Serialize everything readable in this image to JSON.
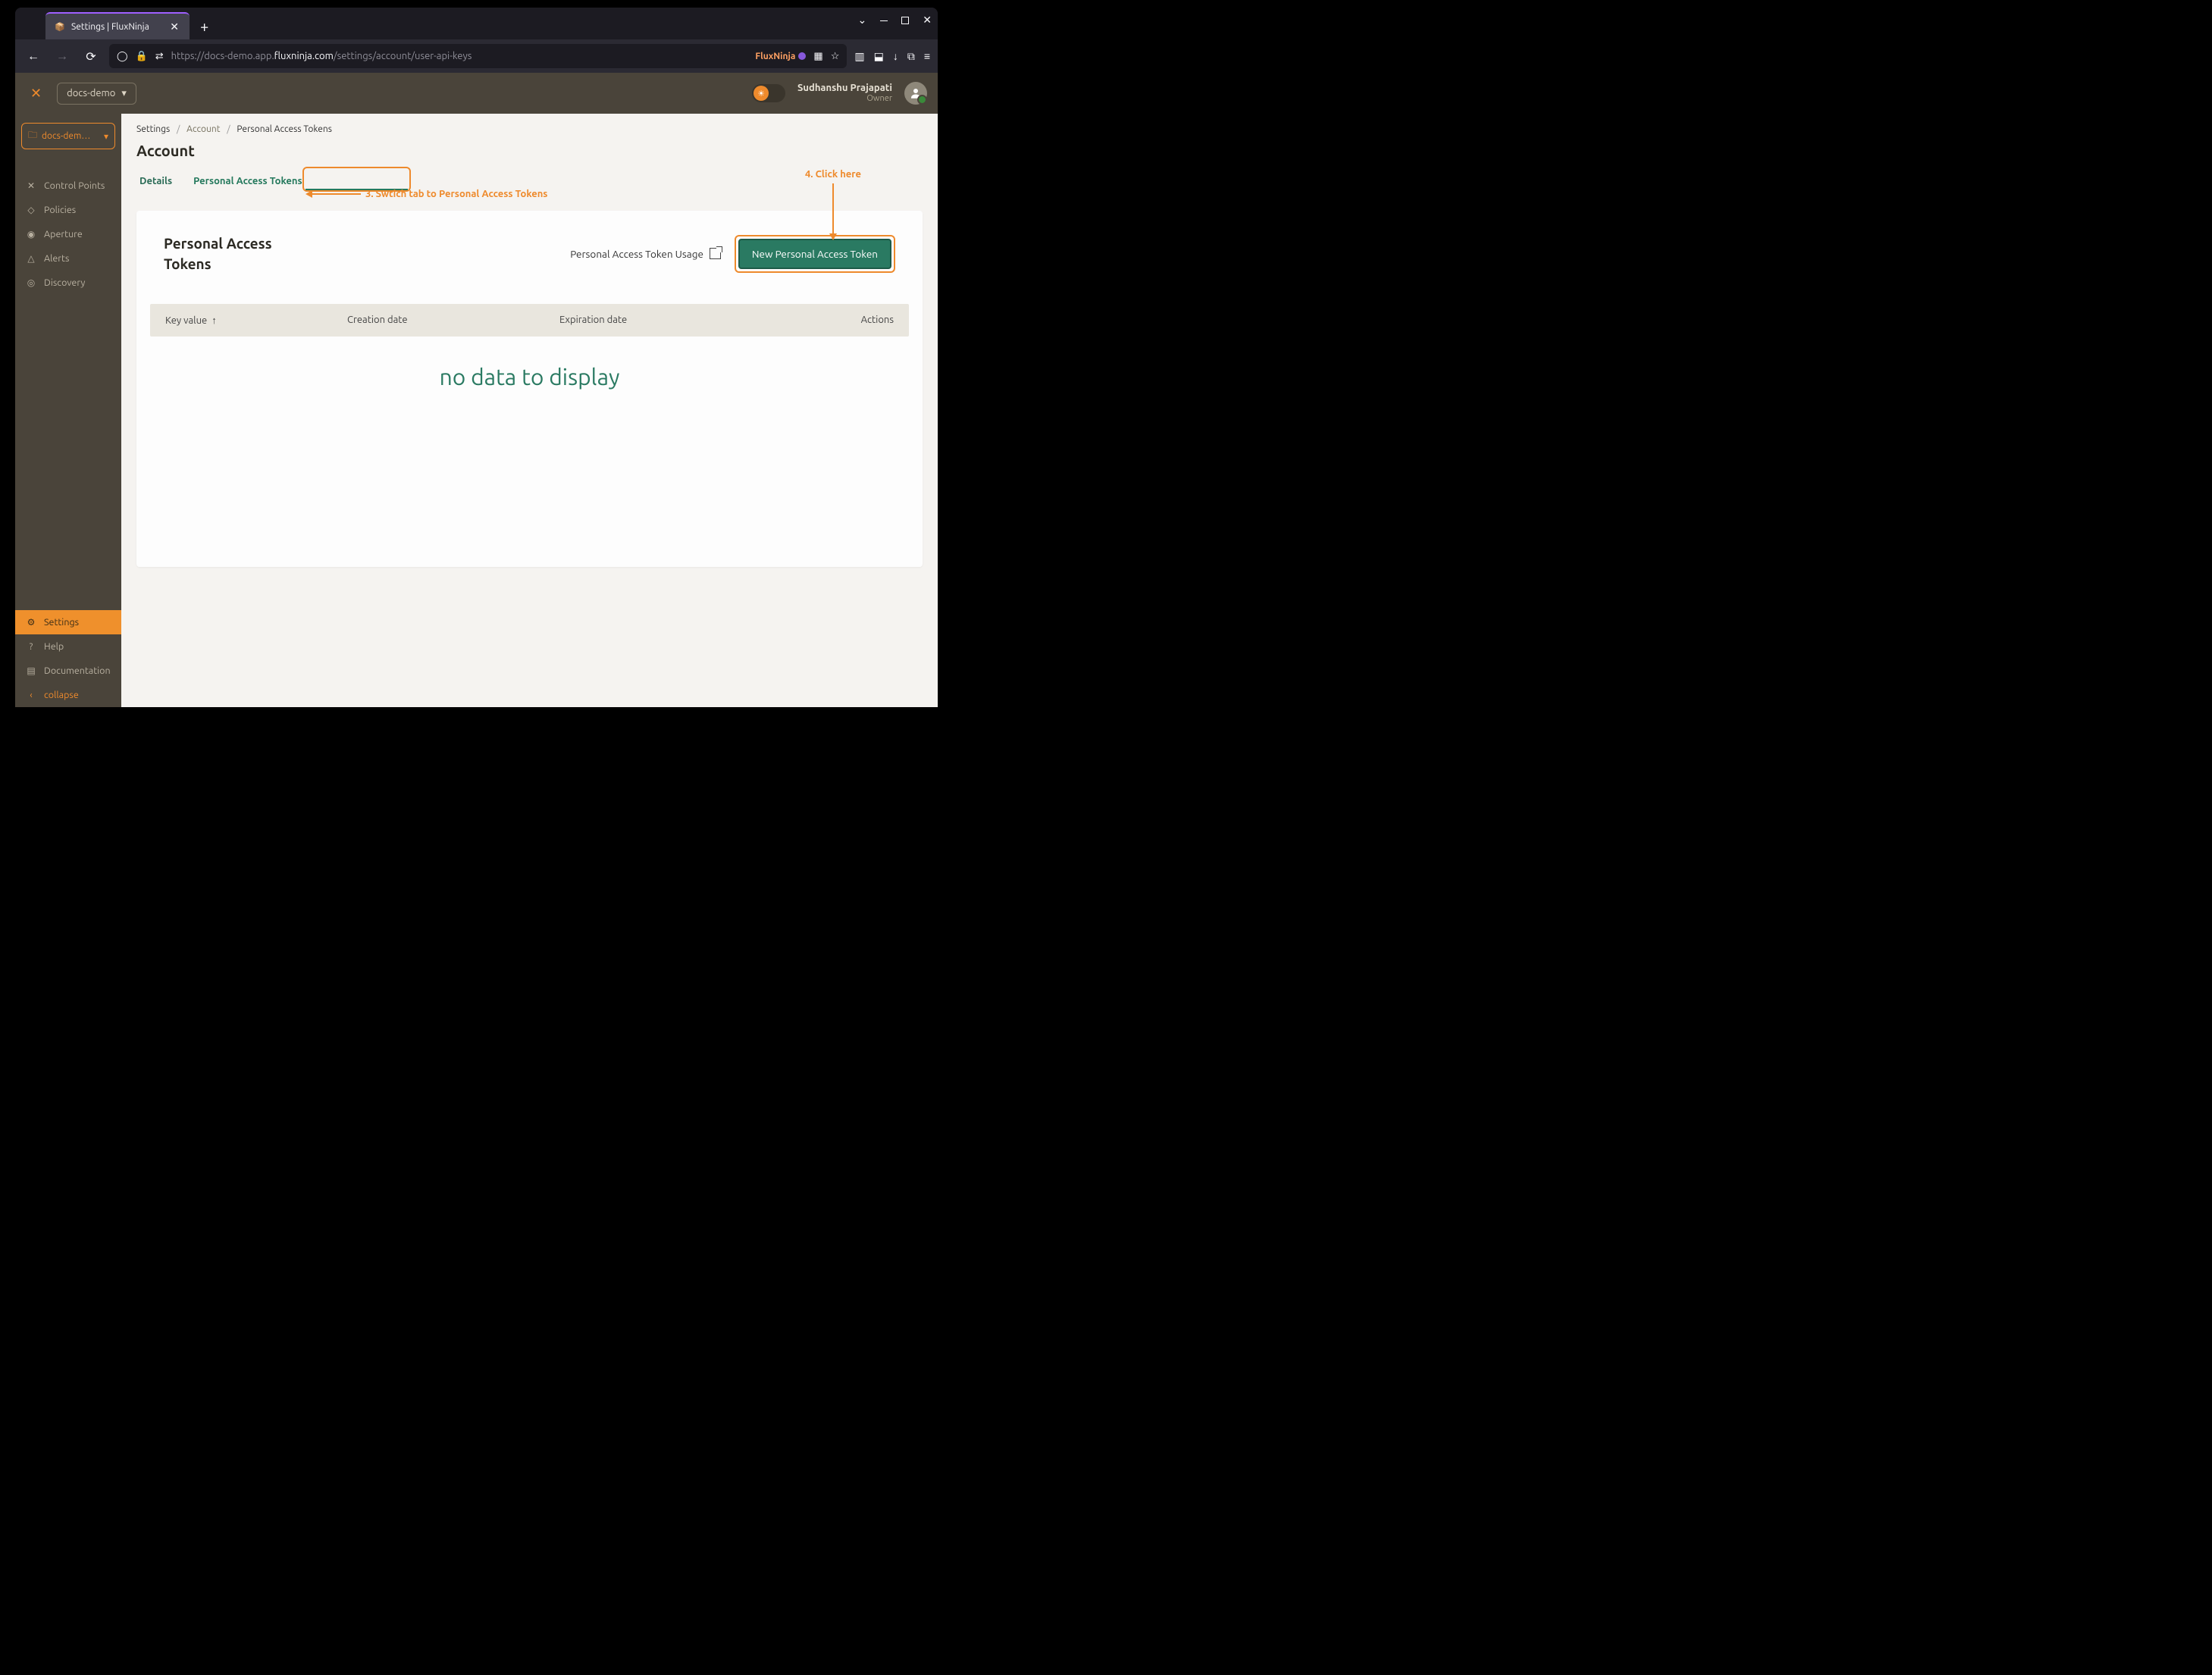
{
  "browser": {
    "tab_title": "Settings | FluxNinja",
    "url_prefix": "https://docs-demo.app.",
    "url_host": "fluxninja.com",
    "url_path": "/settings/account/user-api-keys",
    "brand": "FluxNinja"
  },
  "app": {
    "org": "docs-demo",
    "project": "docs-dem…",
    "user_name": "Sudhanshu Prajapati",
    "user_role": "Owner"
  },
  "sidebar": {
    "items": [
      {
        "label": "Control Points",
        "icon": "✕"
      },
      {
        "label": "Policies",
        "icon": "◇"
      },
      {
        "label": "Aperture",
        "icon": "◉"
      },
      {
        "label": "Alerts",
        "icon": "△"
      },
      {
        "label": "Discovery",
        "icon": "◎"
      }
    ],
    "bottom": [
      {
        "label": "Settings",
        "icon": "⚙",
        "active": true
      },
      {
        "label": "Help",
        "icon": "?"
      },
      {
        "label": "Documentation",
        "icon": "▤"
      }
    ],
    "collapse": "collapse"
  },
  "breadcrumb": {
    "a": "Settings",
    "b": "Account",
    "c": "Personal Access Tokens"
  },
  "page": {
    "title": "Account",
    "tab_details": "Details",
    "tab_pat": "Personal Access Tokens"
  },
  "annotations": {
    "a3": "3. Swtich tab to Personal Access Tokens",
    "a4": "4. Click here"
  },
  "card": {
    "title": "Personal Access Tokens",
    "usage_link": "Personal Access Token Usage",
    "new_btn": "New Personal Access Token",
    "cols": {
      "key": "Key value",
      "creation": "Creation date",
      "expiration": "Expiration date",
      "actions": "Actions"
    },
    "empty": "no data to display"
  }
}
